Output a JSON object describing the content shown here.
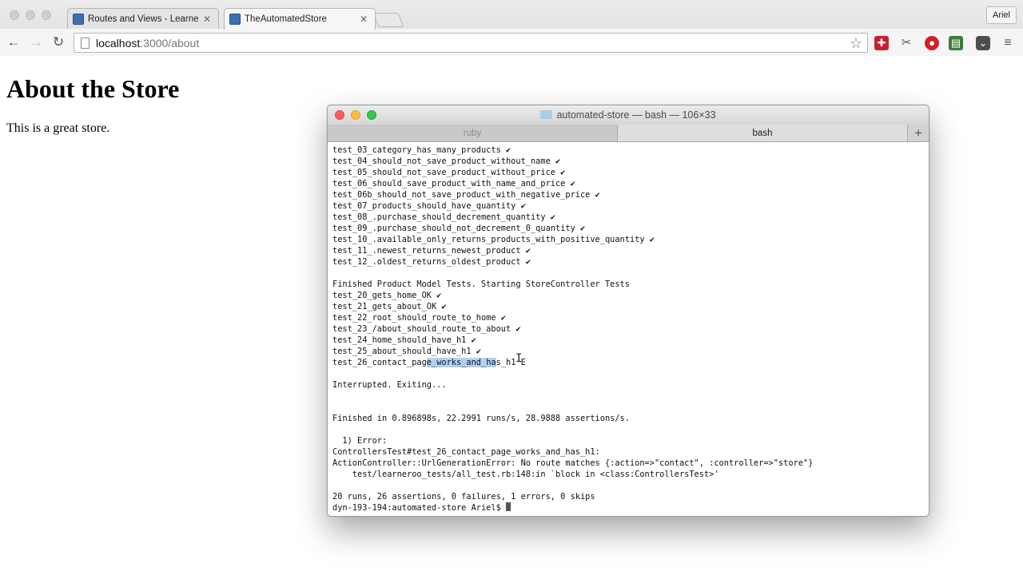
{
  "browser": {
    "tabs": [
      {
        "title": "Routes and Views - Learne",
        "active": false
      },
      {
        "title": "TheAutomatedStore",
        "active": true
      }
    ],
    "profile": "Ariel",
    "url": {
      "host": "localhost",
      "path": ":3000/about"
    }
  },
  "page": {
    "heading": "About the Store",
    "paragraph": "This is a great store."
  },
  "terminal": {
    "title": "automated-store — bash — 106×33",
    "tabs": [
      "ruby",
      "bash"
    ],
    "active_tab": "bash",
    "lines": [
      "test_03_category_has_many_products ✔",
      "test_04_should_not_save_product_without_name ✔",
      "test_05_should_not_save_product_without_price ✔",
      "test_06_should_save_product_with_name_and_price ✔",
      "test_06b_should_not_save_product_with_negative_price ✔",
      "test_07_products_should_have_quantity ✔",
      "test_08_.purchase_should_decrement_quantity ✔",
      "test_09_.purchase_should_not_decrement_0_quantity ✔",
      "test_10_.available_only_returns_products_with_positive_quantity ✔",
      "test_11_.newest_returns_newest_product ✔",
      "test_12_.oldest_returns_oldest_product ✔",
      "",
      "Finished Product Model Tests. Starting StoreController Tests",
      "test_20_gets_home_OK ✔",
      "test_21_gets_about_OK ✔",
      "test_22_root_should_route_to_home ✔",
      "test_23_/about_should_route_to_about ✔",
      "test_24_home_should_have_h1 ✔",
      "test_25_about_should_have_h1 ✔",
      "test_26_contact_page_works_and_has_h1 E",
      "",
      "Interrupted. Exiting...",
      "",
      "",
      "Finished in 0.896898s, 22.2991 runs/s, 28.9888 assertions/s.",
      "",
      "  1) Error:",
      "ControllersTest#test_26_contact_page_works_and_has_h1:",
      "ActionController::UrlGenerationError: No route matches {:action=>\"contact\", :controller=>\"store\"}",
      "    test/learneroo_tests/all_test.rb:148:in `block in <class:ControllersTest>'",
      "",
      "20 runs, 26 assertions, 0 failures, 1 errors, 0 skips",
      "dyn-193-194:automated-store Ariel$ "
    ],
    "selected_line_index": 19,
    "selection": {
      "start": 19,
      "end": 33
    }
  }
}
